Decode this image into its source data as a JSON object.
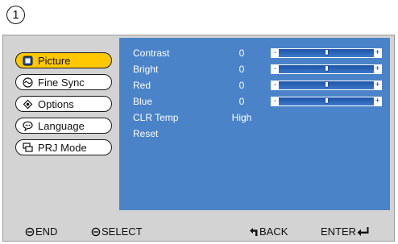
{
  "step_badge": "1",
  "sidebar": {
    "items": [
      {
        "label": "Picture",
        "icon": "picture-icon",
        "active": true
      },
      {
        "label": "Fine Sync",
        "icon": "fine-sync-icon",
        "active": false
      },
      {
        "label": "Options",
        "icon": "options-icon",
        "active": false
      },
      {
        "label": "Language",
        "icon": "language-icon",
        "active": false
      },
      {
        "label": "PRJ Mode",
        "icon": "prj-mode-icon",
        "active": false
      }
    ]
  },
  "menu": {
    "rows": [
      {
        "label": "Contrast",
        "value": "0",
        "slider_level": 0.5
      },
      {
        "label": "Bright",
        "value": "0",
        "slider_level": 0.5
      },
      {
        "label": "Red",
        "value": "0",
        "slider_level": 0.5
      },
      {
        "label": "Blue",
        "value": "0",
        "slider_level": 0.5
      },
      {
        "label": "CLR Temp",
        "value": "High"
      },
      {
        "label": "Reset",
        "value": ""
      }
    ],
    "slider_minus": "-",
    "slider_plus": "+"
  },
  "footer": {
    "end_label": "END",
    "select_label": "SELECT",
    "back_label": "BACK",
    "enter_label": "ENTER"
  },
  "colors": {
    "menu_background": "#4a83c8",
    "active_tab": "#ffc800",
    "screen_background": "#d3d3d3"
  }
}
